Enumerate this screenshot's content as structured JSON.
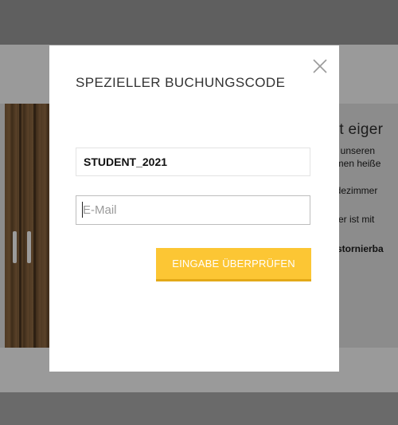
{
  "background": {
    "heading": "nit eiger",
    "lines": [
      "in unseren",
      "nmen heiße",
      "adezimmer",
      "mer ist mit",
      "r stornierba"
    ]
  },
  "modal": {
    "title": "SPEZIELLER BUCHUNGSCODE",
    "close_icon": "close-icon",
    "code_value": "STUDENT_2021",
    "email_placeholder": "E-Mail",
    "submit_label": "EINGABE ÜBERPRÜFEN"
  },
  "colors": {
    "accent": "#fcc634",
    "accent_border": "#e3a918",
    "overlay_gray": "#8a8a8a"
  }
}
